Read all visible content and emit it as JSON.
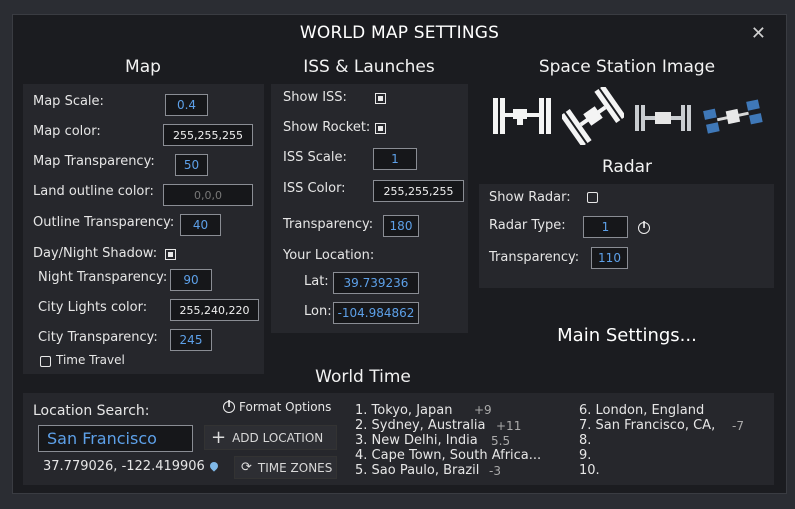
{
  "window": {
    "title": "WORLD MAP SETTINGS",
    "close": "✕"
  },
  "map": {
    "heading": "Map",
    "scale_label": "Map Scale:",
    "scale": "0.4",
    "color_label": "Map color:",
    "color": "255,255,255",
    "transparency_label": "Map Transparency:",
    "transparency": "50",
    "land_outline_label": "Land outline color:",
    "land_outline": "0,0,0",
    "outline_transparency_label": "Outline Transparency:",
    "outline_transparency": "40",
    "day_night_label": "Day/Night Shadow:",
    "night_transparency_label": "Night Transparency:",
    "night_transparency": "90",
    "city_lights_label": "City Lights color:",
    "city_lights": "255,240,220",
    "city_transparency_label": "City Transparency:",
    "city_transparency": "245",
    "time_travel_label": "Time Travel"
  },
  "iss": {
    "heading": "ISS & Launches",
    "show_iss_label": "Show ISS:",
    "show_rocket_label": "Show Rocket:",
    "scale_label": "ISS Scale:",
    "scale": "1",
    "color_label": "ISS Color:",
    "color": "255,255,255",
    "transparency_label": "Transparency:",
    "transparency": "180",
    "your_location_label": "Your Location:",
    "lat_label": "Lat:",
    "lat": "39.739236",
    "lon_label": "Lon:",
    "lon": "-104.984862"
  },
  "station": {
    "heading": "Space Station Image"
  },
  "radar": {
    "heading": "Radar",
    "show_label": "Show Radar:",
    "type_label": "Radar Type:",
    "type": "1",
    "transparency_label": "Transparency:",
    "transparency": "110"
  },
  "main_settings": "Main Settings...",
  "world_time": {
    "heading": "World Time",
    "location_search_label": "Location Search:",
    "format_options": "Format Options",
    "search_value": "San Francisco",
    "add_location": "ADD LOCATION",
    "coords": "37.779026, -122.419906",
    "time_zones": "TIME ZONES",
    "list": [
      {
        "label": "1. Tokyo, Japan",
        "offset": "+9"
      },
      {
        "label": "2. Sydney, Australia",
        "offset": "+11"
      },
      {
        "label": "3. New Delhi, India",
        "offset": "5.5"
      },
      {
        "label": "4. Cape Town, South Africa...",
        "offset": ""
      },
      {
        "label": "5. Sao Paulo, Brazil",
        "offset": "-3"
      },
      {
        "label": "6. London, England",
        "offset": ""
      },
      {
        "label": "7. San Francisco, CA,",
        "offset": "-7"
      },
      {
        "label": "8.",
        "offset": ""
      },
      {
        "label": "9.",
        "offset": ""
      },
      {
        "label": "10.",
        "offset": ""
      }
    ]
  },
  "colors": {
    "accent_blue": "#5da0e8",
    "background": "#1b1c20",
    "panel": "#26272c"
  }
}
